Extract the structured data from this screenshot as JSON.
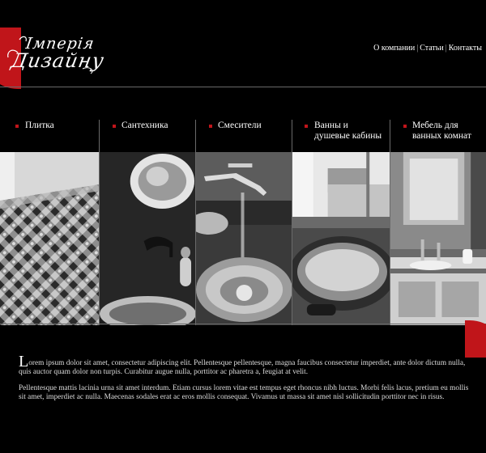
{
  "header": {
    "logo": {
      "line1": "Імперія",
      "line2": "Дизайну"
    },
    "nav": [
      {
        "label": "О компании"
      },
      {
        "label": "Статьи"
      },
      {
        "label": "Контакты"
      }
    ],
    "nav_separator": "|"
  },
  "categories": [
    {
      "label_line1": "Плитка",
      "label_line2": "",
      "image": "tile-floor-photo"
    },
    {
      "label_line1": "Сантехника",
      "label_line2": "",
      "image": "sanitary-washbasin-photo"
    },
    {
      "label_line1": "Смесители",
      "label_line2": "",
      "image": "faucet-basin-photo"
    },
    {
      "label_line1": "Ванны и",
      "label_line2": "душевые кабины",
      "image": "bathtub-photo"
    },
    {
      "label_line1": "Мебель для",
      "label_line2": "ванных комнат",
      "image": "bathroom-furniture-photo"
    }
  ],
  "content": {
    "para1_initial": "L",
    "para1_rest": "orem ipsum dolor sit amet, consectetur adipiscing elit. Pellentesque pellentesque, magna faucibus consectetur imperdiet, ante dolor dictum nulla, quis auctor quam dolor non turpis. Curabitur augue nulla, porttitor ac pharetra a, feugiat at velit.",
    "para2": "Pellentesque mattis lacinia urna sit amet interdum. Etiam cursus lorem vitae est tempus eget rhoncus nibh luctus. Morbi felis lacus, pretium eu mollis sit amet, imperdiet ac nulla. Maecenas sodales erat ac eros mollis consequat. Vivamus ut massa sit amet nisl sollicitudin porttitor nec in risus."
  },
  "colors": {
    "background": "#000000",
    "accent": "#c0151a",
    "divider": "#6a6a6a",
    "text": "#ffffff"
  }
}
